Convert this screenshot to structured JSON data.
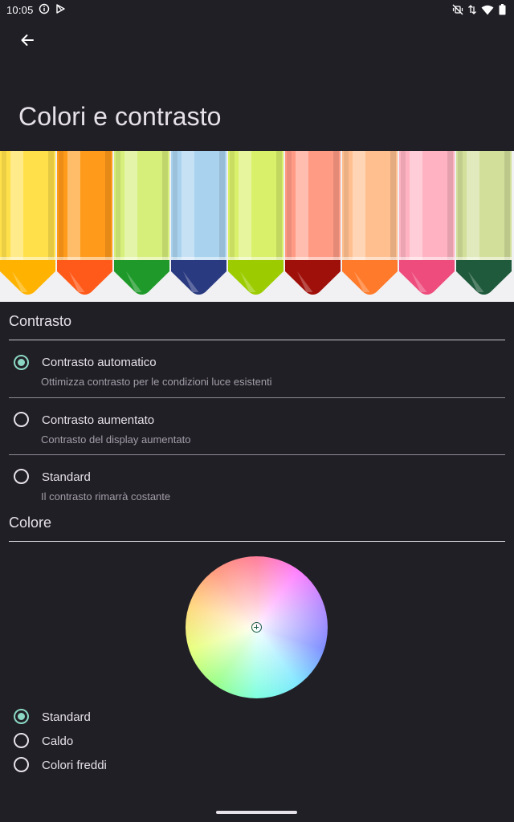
{
  "status_bar": {
    "time": "10:05",
    "left_icons": [
      "info-icon",
      "play-store-icon"
    ],
    "right_icons": [
      "mute-vibrate-icon",
      "data-arrows-icon",
      "wifi-icon",
      "battery-icon"
    ]
  },
  "app_bar": {
    "back_icon": "arrow-back-icon",
    "title": "Colori e contrasto"
  },
  "banner": {
    "crayons": [
      {
        "body": "#ffe04a",
        "tip": "#ffb300"
      },
      {
        "body": "#ff9a1a",
        "tip": "#ff5a1a"
      },
      {
        "body": "#d6ef7a",
        "tip": "#1f9a2a"
      },
      {
        "body": "#a9d2ee",
        "tip": "#2a3a80"
      },
      {
        "body": "#d9f06a",
        "tip": "#9ccc00"
      },
      {
        "body": "#ff9a85",
        "tip": "#a0100a"
      },
      {
        "body": "#ffbf8f",
        "tip": "#ff7a2a"
      },
      {
        "body": "#ffb3c2",
        "tip": "#ee4c7c"
      },
      {
        "body": "#d2df9a",
        "tip": "#1f5a3c"
      }
    ]
  },
  "contrast": {
    "title": "Contrasto",
    "options": [
      {
        "label": "Contrasto automatico",
        "description": "Ottimizza contrasto per le condizioni luce esistenti",
        "selected": true
      },
      {
        "label": "Contrasto aumentato",
        "description": "Contrasto del display aumentato",
        "selected": false
      },
      {
        "label": "Standard",
        "description": "Il contrasto rimarrà costante",
        "selected": false
      }
    ]
  },
  "color": {
    "title": "Colore",
    "wheel_icon": "color-wheel",
    "options": [
      {
        "label": "Standard",
        "selected": true
      },
      {
        "label": "Caldo",
        "selected": false
      },
      {
        "label": "Colori freddi",
        "selected": false
      }
    ]
  },
  "colors": {
    "background": "#211f26",
    "accent": "#8bd7c4",
    "text": "#e6e1e9",
    "secondary_text": "#a29ea8"
  }
}
